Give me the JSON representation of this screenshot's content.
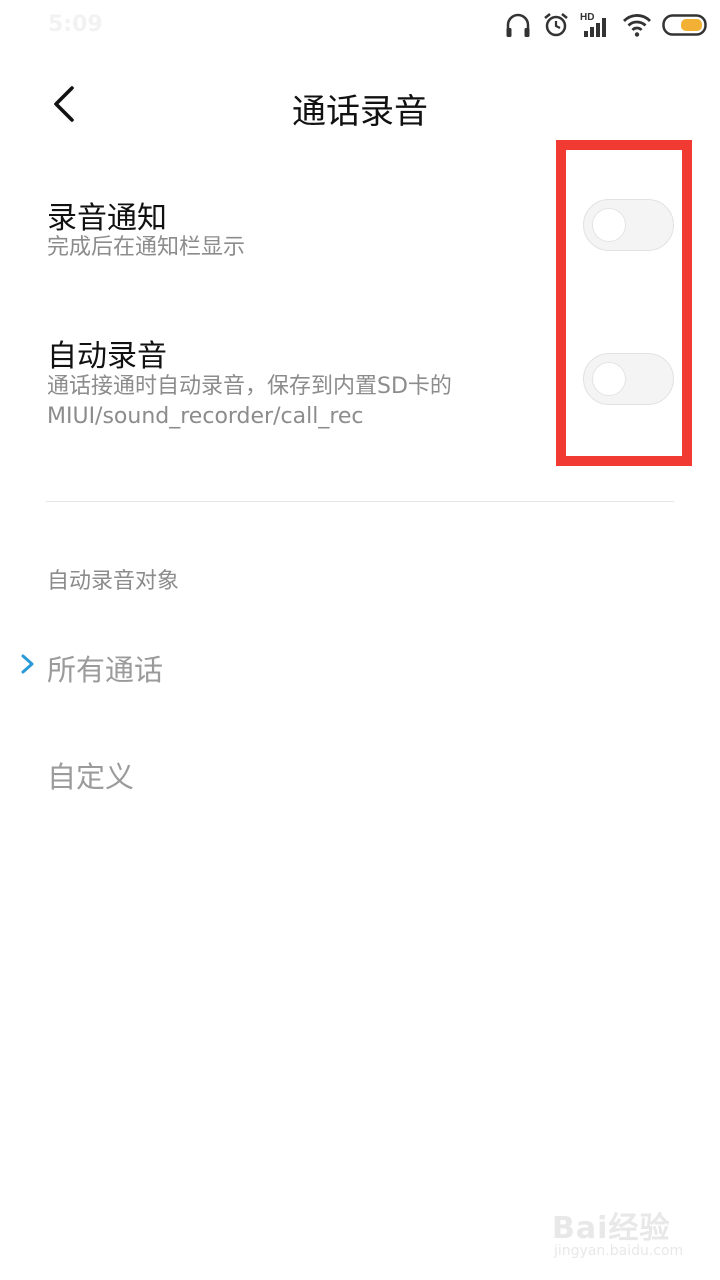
{
  "status_bar": {
    "time": "5:09",
    "icons": [
      "headphones-icon",
      "alarm-icon",
      "hd-signal-icon",
      "wifi-icon",
      "battery-icon"
    ],
    "hd_label": "HD",
    "battery_color": "#f2b135"
  },
  "header": {
    "back_icon": "back-arrow-icon",
    "title": "通话录音"
  },
  "settings": [
    {
      "title": "录音通知",
      "subtitle": "完成后在通知栏显示",
      "enabled": false
    },
    {
      "title": "自动录音",
      "subtitle_line1": "通话接通时自动录音，保存到内置SD卡的",
      "subtitle_line2": "MIUI/sound_recorder/call_rec",
      "enabled": false
    }
  ],
  "auto_record_section": {
    "header": "自动录音对象",
    "options": [
      {
        "label": "所有通话",
        "selected": true
      },
      {
        "label": "自定义",
        "selected": false
      }
    ],
    "check_color": "#2a9ad6"
  },
  "highlight_color": "#f03a32",
  "watermark": {
    "main": "Bai经验",
    "sub": "jingyan.baidu.com"
  }
}
